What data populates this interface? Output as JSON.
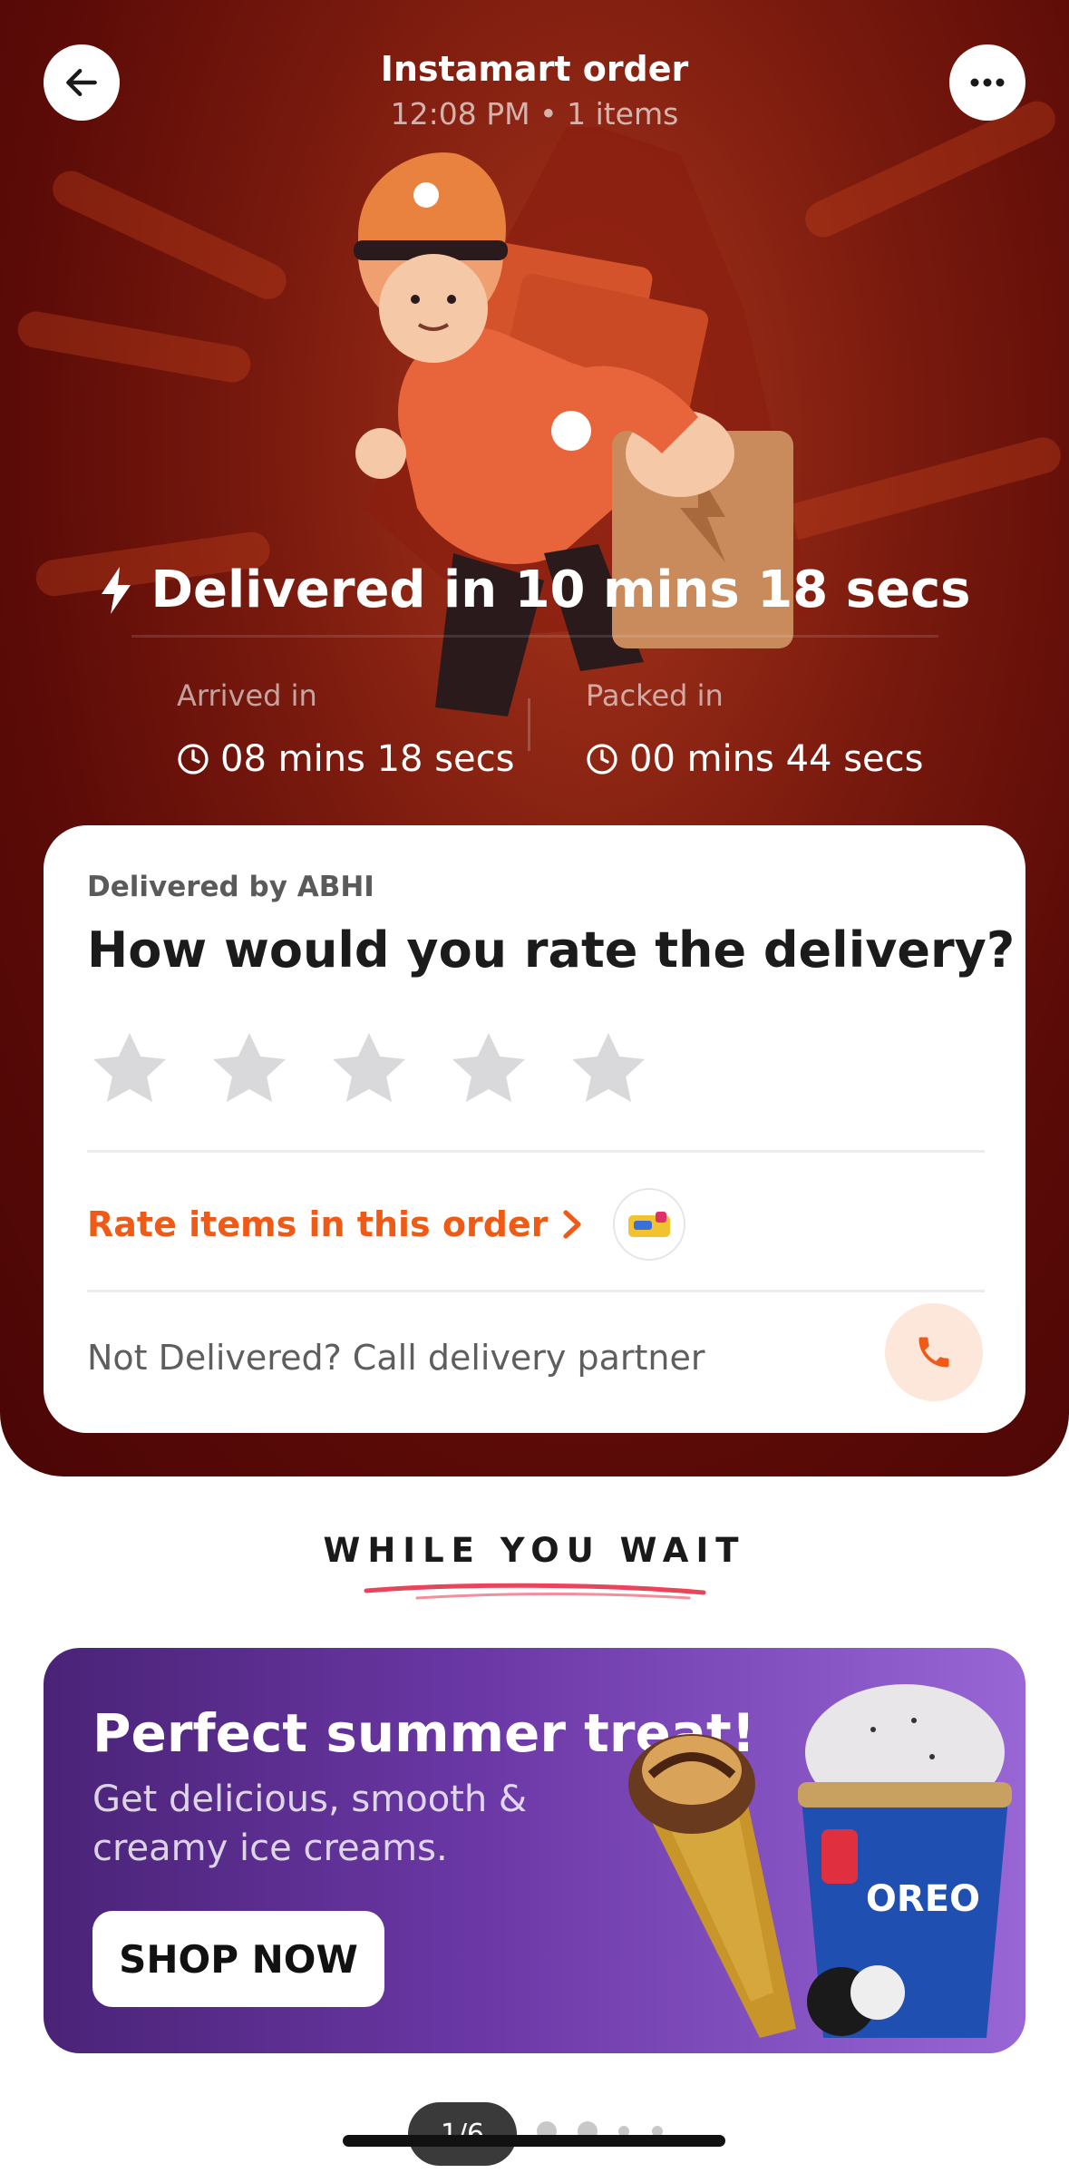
{
  "header": {
    "title": "Instamart order",
    "subtitle": "12:08 PM • 1 items"
  },
  "status": {
    "delivered_text": "Delivered in 10 mins 18 secs",
    "arrived_label": "Arrived in",
    "arrived_value": "08 mins 18 secs",
    "packed_label": "Packed in",
    "packed_value": "00 mins 44 secs"
  },
  "rating_card": {
    "delivered_by": "Delivered by ABHI",
    "question": "How would you rate the delivery?",
    "star_count": 5,
    "rating": 0,
    "rate_items_label": "Rate items in this order",
    "not_delivered_text": "Not Delivered? Call delivery partner"
  },
  "section": {
    "while_you_wait": "WHILE YOU WAIT"
  },
  "banner": {
    "title": "Perfect summer treat!",
    "subtitle": "Get delicious, smooth & creamy ice creams.",
    "button_label": "SHOP NOW",
    "product_text": "OREO"
  },
  "pager": {
    "label": "1/6"
  },
  "colors": {
    "hero_bg": "#5a0a07",
    "accent_orange": "#ef5a16",
    "banner_purple": "#6b38a6"
  },
  "icons": [
    "back-arrow-icon",
    "more-icon",
    "lightning-icon",
    "clock-icon",
    "star-icon",
    "chevron-right-icon",
    "phone-icon"
  ]
}
